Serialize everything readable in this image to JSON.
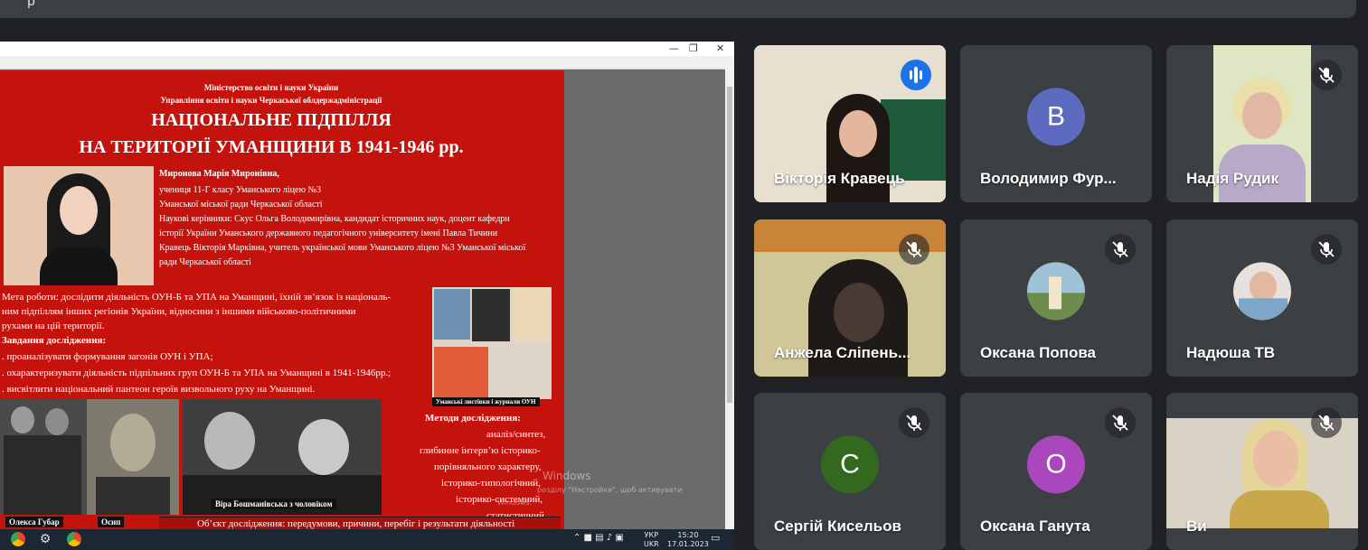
{
  "meeting": {
    "title_fragment": "р"
  },
  "slide": {
    "ministry": "Міністерство освіти і науки України",
    "department": "Управління освіти і науки Черкаської облдержадміністрації",
    "title_line1": "НАЦІОНАЛЬНЕ ПІДПІЛЛЯ",
    "title_line2": "НА ТЕРИТОРІЇ УМАНЩИНИ В 1941-1946 рр.",
    "author_lines": [
      "Миронова Марія Миронівна,",
      "учениця 11-Г класу Уманського ліцею №3",
      "Уманської міської ради Черкаської області",
      " Наукові керівники: Скус Ольга Володимирівна,  кандидат історичних наук,  доцент кафедри",
      "історії України Уманського державного педагогічного університету імені Павла Тичини",
      "Кравець Вікторія Марківна, учитель української мови Уманського ліцею №3 Уманської   міської",
      "ради Черкаської області"
    ],
    "goal_lines": [
      "Мета роботи: дослідити діяльність ОУН-Б та УПА на Уманщині, їхній зв’язок із національ-",
      "ним підпіллям інших регіонів України, відносини з іншими військово-політичними",
      "рухами на цій території."
    ],
    "tasks_heading": "Завдання дослідження:",
    "tasks": [
      ".  проаналізувати формування загонів ОУН і УПА;",
      ".  охарактеризувати діяльність підпільних груп ОУН-Б та УПА на Уманщині в 1941-1946рр.;",
      ".  висвітлити національний пантеон героїв визвольного руху на Уманщині."
    ],
    "leaflets_caption": "Уманські листівки і журнали ОУН",
    "methods_lines": [
      "Методи дослідження:",
      "аналіз/синтез,",
      "глибинне інтерв’ю історико-",
      "порівняльного характеру,",
      "історико-типологічний,",
      "історико-системний,",
      "статистичний."
    ],
    "caption_left": "Олекса Губар",
    "caption_mid": "Осип",
    "caption_right": "Віра Бошманівська з чоловіком",
    "object_line": "Об’єкт дослідження: передумови, причини, перебіг і результати діяльності"
  },
  "watermark": {
    "line1": "Windows",
    "line2": "розділу \"Настройки\", щоб активувати",
    "line3": "Windows."
  },
  "taskbar": {
    "lang": "УКР",
    "lang2": "UKR",
    "time": "15:20",
    "date": "17.01.2023"
  },
  "colors": {
    "background": "#202124",
    "tile": "#3c4043",
    "speaking": "#1a73e8",
    "slide_red": "#c4120d"
  },
  "participants": [
    {
      "name": "Вікторія Кравець",
      "type": "video",
      "status": "speaking"
    },
    {
      "name": "Володимир Фур...",
      "type": "initial",
      "initial": "B",
      "color": "#5c6bc0"
    },
    {
      "name": "Надія Рудик",
      "type": "video",
      "status": "muted"
    },
    {
      "name": "Анжела Сліпень...",
      "type": "video",
      "status": "muted"
    },
    {
      "name": "Оксана Попова",
      "type": "photo",
      "status": "muted"
    },
    {
      "name": "Надюша ТВ",
      "type": "photo",
      "status": "muted"
    },
    {
      "name": "Сергій Кисельов",
      "type": "initial",
      "initial": "C",
      "color": "#33691e",
      "status": "muted"
    },
    {
      "name": "Оксана Ганута",
      "type": "initial",
      "initial": "O",
      "color": "#ab47bc",
      "status": "muted"
    },
    {
      "name": "Ви",
      "type": "video",
      "status": "muted"
    }
  ]
}
